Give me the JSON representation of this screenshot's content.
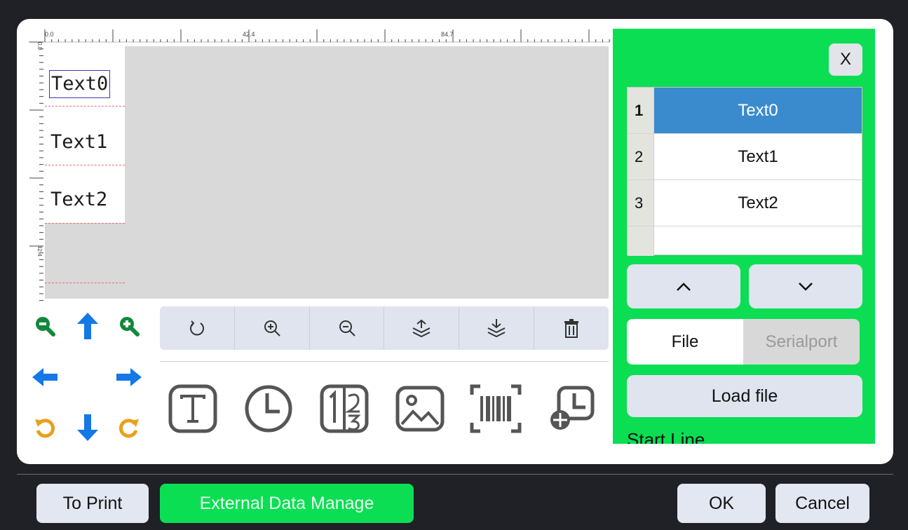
{
  "ruler": {
    "top_labels": [
      "0.0",
      "42.4",
      "84.7"
    ],
    "left_labels": [
      "0.0",
      "42.4"
    ]
  },
  "canvas": {
    "items": [
      "Text0",
      "Text1",
      "Text2"
    ],
    "selected_index": 0
  },
  "keypad": {
    "icons": [
      "zoom-out-icon",
      "arrow-up-icon",
      "zoom-in-icon",
      "arrow-left-icon",
      "arrow-right-icon",
      "rotate-left-icon",
      "arrow-down-icon",
      "rotate-right-icon"
    ],
    "colors": {
      "green": "#12883a",
      "blue": "#1478e6",
      "orange": "#e6a21c"
    }
  },
  "toolbar": {
    "icons": [
      "rotate-icon",
      "zoom-in-icon",
      "zoom-out-icon",
      "layer-up-icon",
      "layer-down-icon",
      "trash-icon"
    ]
  },
  "insert_tools": [
    "text-tool-icon",
    "clock-tool-icon",
    "counter-tool-icon",
    "image-tool-icon",
    "barcode-tool-icon",
    "shift-code-tool-icon"
  ],
  "panel": {
    "close_label": "X",
    "list": [
      {
        "num": "1",
        "label": "Text0",
        "selected": true
      },
      {
        "num": "2",
        "label": "Text1",
        "selected": false
      },
      {
        "num": "3",
        "label": "Text2",
        "selected": false
      }
    ],
    "tabs": {
      "file": "File",
      "serialport": "Serialport"
    },
    "load_file": "Load file",
    "start_line": "Start Line",
    "accent": "#0bde53",
    "selected_row_color": "#3a8bcd"
  },
  "footer": {
    "to_print": "To Print",
    "external_data": "External Data Manage",
    "ok": "OK",
    "cancel": "Cancel"
  }
}
